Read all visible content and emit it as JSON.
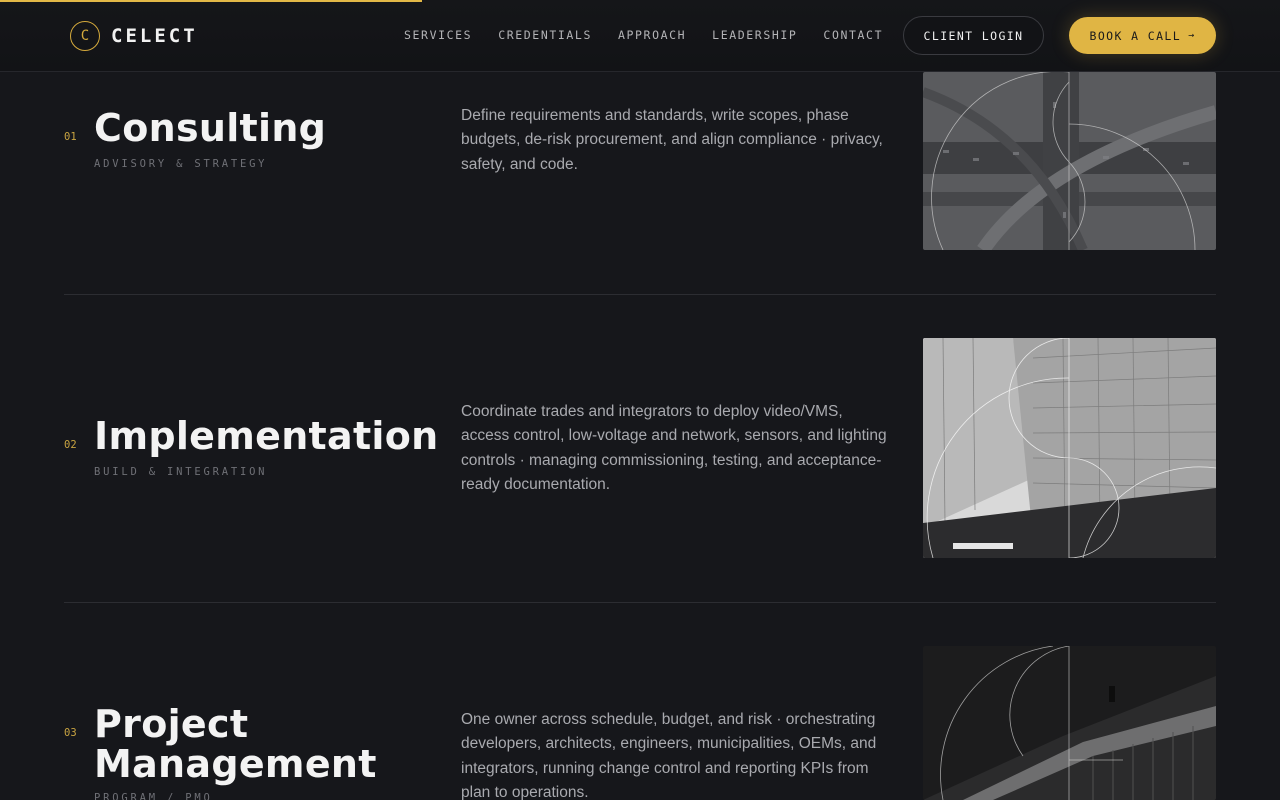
{
  "progress": {
    "scroll_fraction": 0.33
  },
  "brand": {
    "mark": "C",
    "name": "CELECT"
  },
  "nav": {
    "links": [
      "SERVICES",
      "CREDENTIALS",
      "APPROACH",
      "LEADERSHIP",
      "CONTACT"
    ],
    "login_label": "CLIENT LOGIN",
    "cta_label": "BOOK A CALL",
    "cta_arrow": "→"
  },
  "colors": {
    "accent": "#e0b544",
    "background": "#16171b"
  },
  "services": [
    {
      "number": "01",
      "title": "Consulting",
      "subtitle": "ADVISORY & STRATEGY",
      "description": "Define requirements and standards, write scopes, phase budgets, de-risk procurement, and align compliance · privacy, safety, and code.",
      "image": "aerial-highway-interchange"
    },
    {
      "number": "02",
      "title": "Implementation",
      "subtitle": "BUILD & INTEGRATION",
      "description": "Coordinate trades and integrators to deploy video/VMS, access control, low-voltage and network, sensors, and lighting controls · managing commissioning, testing, and acceptance-ready documentation.",
      "image": "glass-office-building"
    },
    {
      "number": "03",
      "title": "Project Management",
      "subtitle": "PROGRAM / PMO",
      "description": "One owner across schedule, budget, and risk · orchestrating developers, architects, engineers, municipalities, OEMs, and integrators, running change control and reporting KPIs from plan to operations.",
      "image": "modern-interior-balcony"
    }
  ]
}
